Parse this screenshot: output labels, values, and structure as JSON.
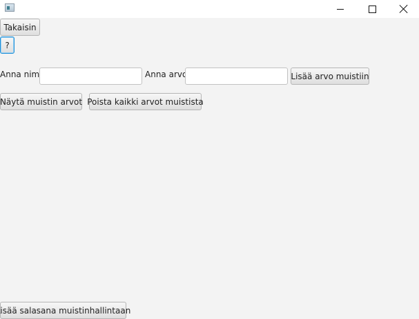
{
  "window": {
    "icon": "app-window-icon",
    "controls": {
      "minimize": "minimize-icon",
      "maximize": "maximize-icon",
      "close": "close-icon"
    }
  },
  "toolbar": {
    "back_label": "Takaisin",
    "help_label": "?"
  },
  "form": {
    "name_label": "Anna nimi",
    "name_value": "",
    "value_label": "Anna arvo",
    "value_value": "",
    "add_button_label": "Lisää arvo muistiin"
  },
  "actions": {
    "show_label": "Näytä muistin arvot",
    "delete_all_label": "Poista kaikki arvot muistista"
  },
  "footer": {
    "add_password_label": "Lisää salasana muistinhallintaan"
  },
  "colors": {
    "background": "#f3f3f3",
    "focus_accent": "#1e90d8"
  }
}
